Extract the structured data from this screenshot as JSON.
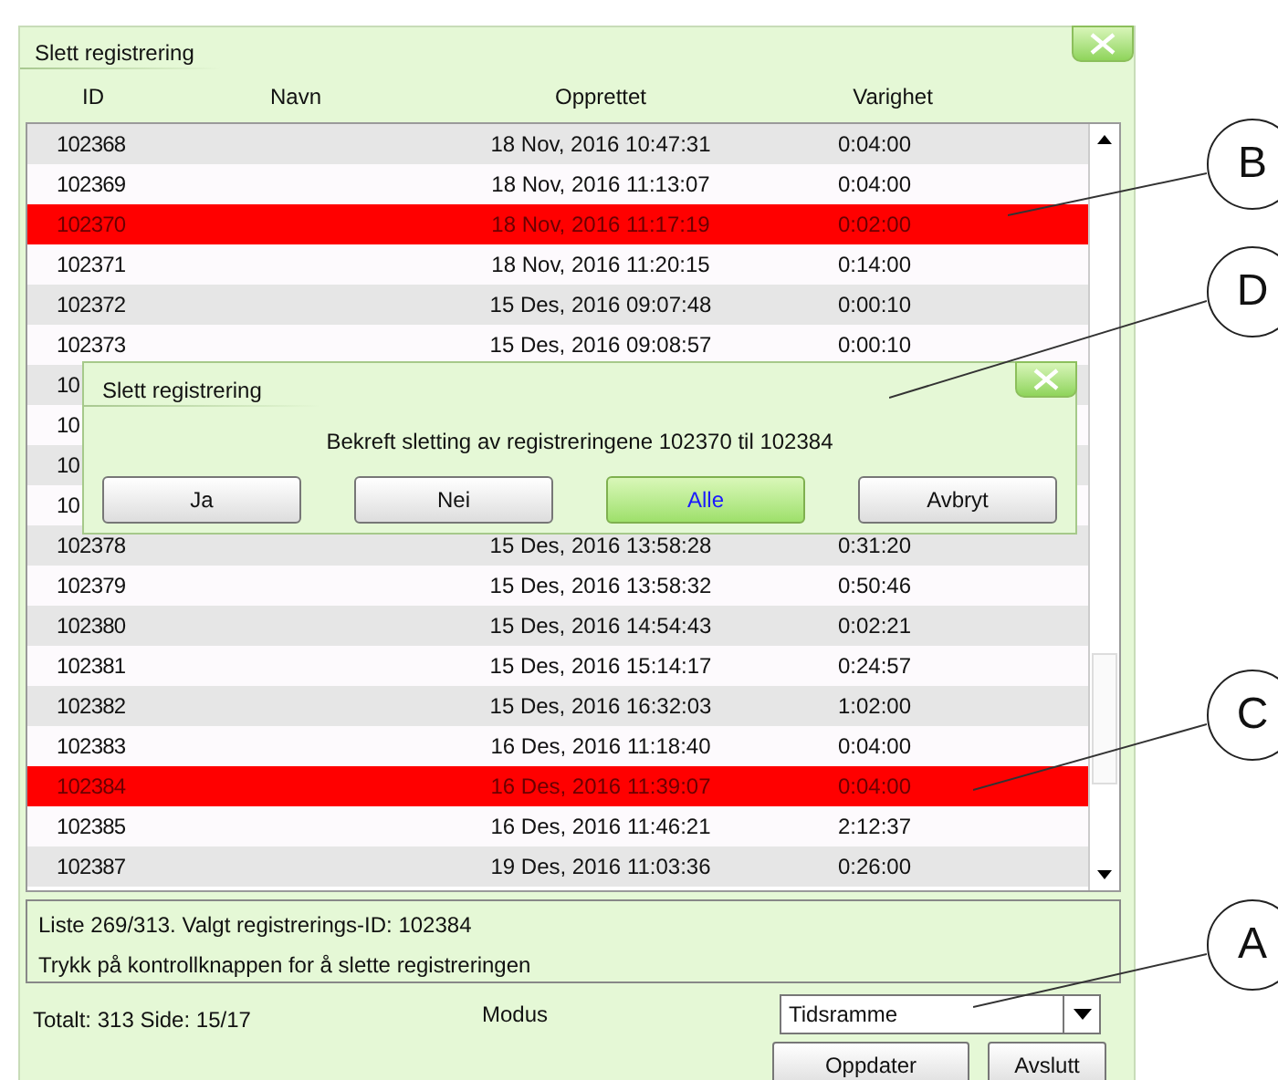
{
  "window": {
    "title": "Slett registrering"
  },
  "table": {
    "columns": [
      "ID",
      "Navn",
      "Opprettet",
      "Varighet"
    ],
    "rows": [
      {
        "id": "102368",
        "created": "18 Nov, 2016 10:47:31",
        "duration": "0:04:00",
        "selected": false
      },
      {
        "id": "102369",
        "created": "18 Nov, 2016 11:13:07",
        "duration": "0:04:00",
        "selected": false
      },
      {
        "id": "102370",
        "created": "18 Nov, 2016 11:17:19",
        "duration": "0:02:00",
        "selected": true
      },
      {
        "id": "102371",
        "created": "18 Nov, 2016 11:20:15",
        "duration": "0:14:00",
        "selected": false
      },
      {
        "id": "102372",
        "created": "15 Des, 2016 09:07:48",
        "duration": "0:00:10",
        "selected": false
      },
      {
        "id": "102373",
        "created": "15 Des, 2016 09:08:57",
        "duration": "0:00:10",
        "selected": false
      },
      {
        "id": "10",
        "selected": false
      },
      {
        "id": "10",
        "selected": false
      },
      {
        "id": "10",
        "selected": false
      },
      {
        "id": "10",
        "selected": false
      },
      {
        "id": "102378",
        "created": "15 Des, 2016 13:58:28",
        "duration": "0:31:20",
        "selected": false
      },
      {
        "id": "102379",
        "created": "15 Des, 2016 13:58:32",
        "duration": "0:50:46",
        "selected": false
      },
      {
        "id": "102380",
        "created": "15 Des, 2016 14:54:43",
        "duration": "0:02:21",
        "selected": false
      },
      {
        "id": "102381",
        "created": "15 Des, 2016 15:14:17",
        "duration": "0:24:57",
        "selected": false
      },
      {
        "id": "102382",
        "created": "15 Des, 2016 16:32:03",
        "duration": "1:02:00",
        "selected": false
      },
      {
        "id": "102383",
        "created": "16 Des, 2016 11:18:40",
        "duration": "0:04:00",
        "selected": false
      },
      {
        "id": "102384",
        "created": "16 Des, 2016 11:39:07",
        "duration": "0:04:00",
        "selected": true
      },
      {
        "id": "102385",
        "created": "16 Des, 2016 11:46:21",
        "duration": "2:12:37",
        "selected": false
      },
      {
        "id": "102387",
        "created": "19 Des, 2016 11:03:36",
        "duration": "0:26:00",
        "selected": false
      }
    ]
  },
  "status_lines": [
    "Liste 269/313. Valgt registrerings-ID: 102384",
    "Trykk på kontrollknappen for å slette registreringen"
  ],
  "footer": {
    "totals": "Totalt: 313 Side: 15/17",
    "mode_label": "Modus",
    "mode_value": "Tidsramme",
    "buttons": [
      "Oppdater",
      "Avslutt"
    ]
  },
  "dialog": {
    "title": "Slett registrering",
    "message": "Bekreft sletting av registreringene 102370 til 102384",
    "buttons": [
      {
        "label": "Ja",
        "selected": false
      },
      {
        "label": "Nei",
        "selected": false
      },
      {
        "label": "Alle",
        "selected": true
      },
      {
        "label": "Avbryt",
        "selected": false
      }
    ]
  },
  "callouts": [
    {
      "label": "B"
    },
    {
      "label": "D"
    },
    {
      "label": "C"
    },
    {
      "label": "A"
    }
  ]
}
